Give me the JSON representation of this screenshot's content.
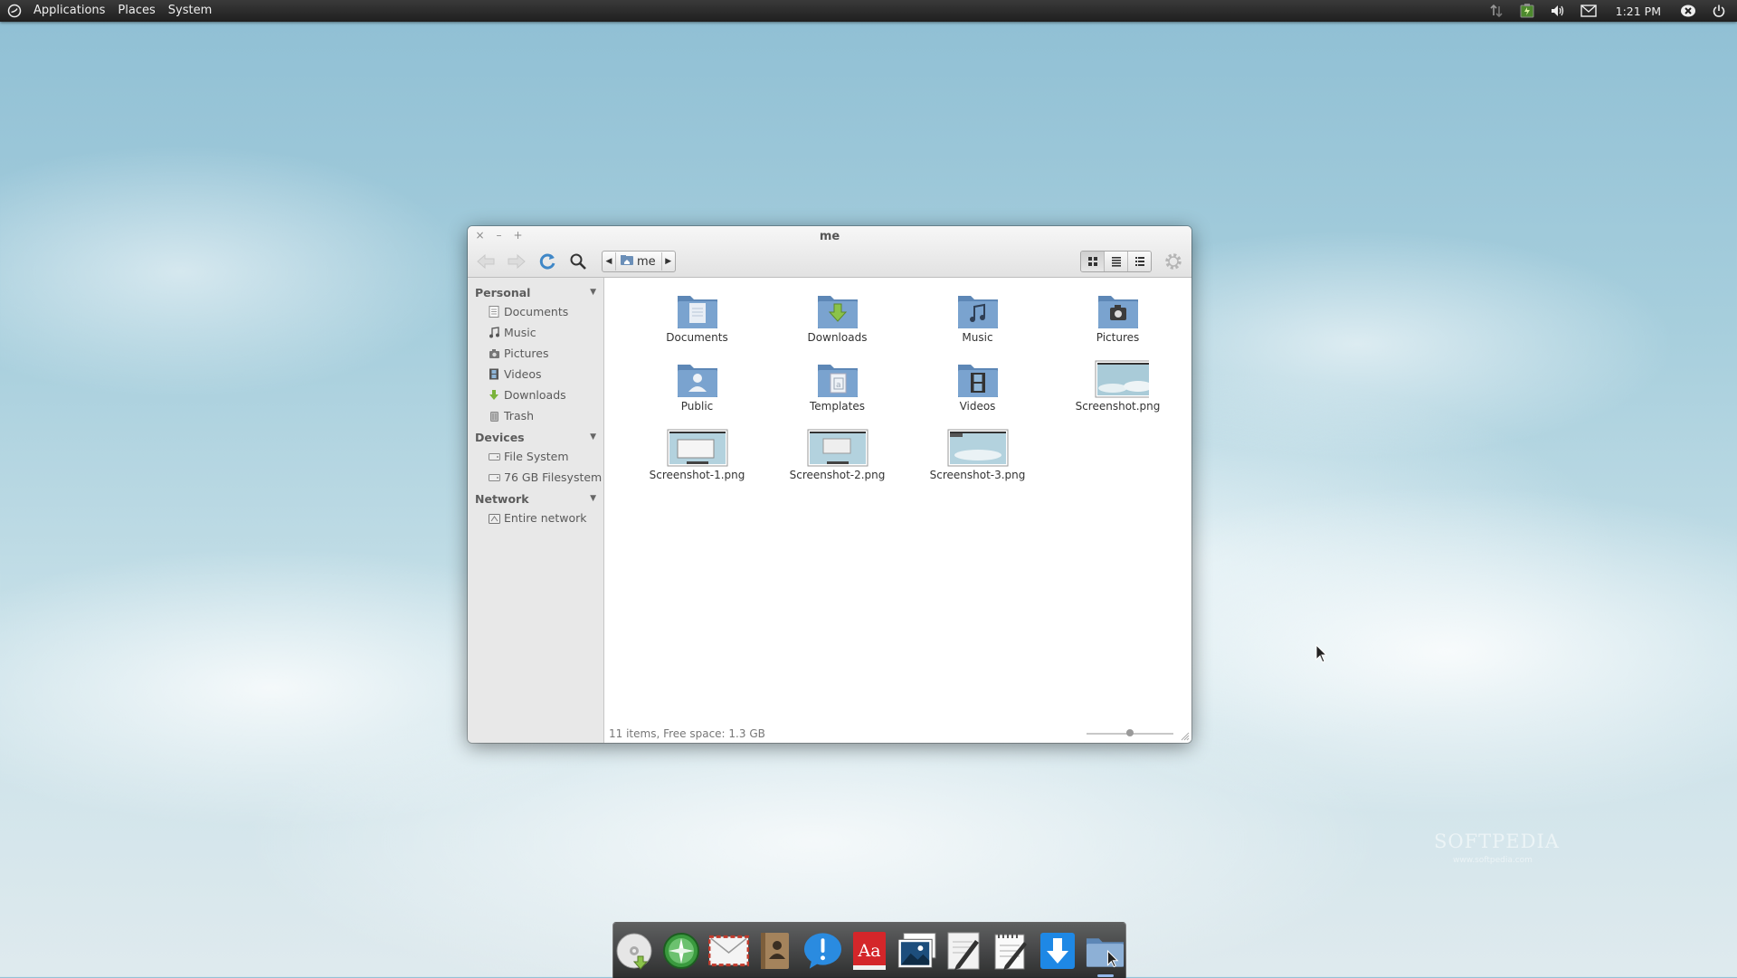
{
  "panel": {
    "menus": [
      "Applications",
      "Places",
      "System"
    ],
    "clock": "1:21 PM",
    "tray_icons": [
      "network-icon",
      "battery-icon",
      "volume-icon",
      "mail-icon",
      "user-status-icon",
      "power-icon"
    ]
  },
  "window": {
    "title": "me",
    "path": "me",
    "controls": [
      "×",
      "–",
      "+"
    ],
    "view_modes": [
      "icon-view",
      "list-view",
      "compact-view"
    ],
    "active_view": "icon-view"
  },
  "sidebar": {
    "sections": [
      {
        "title": "Personal",
        "items": [
          {
            "label": "Documents",
            "icon": "documents-icon"
          },
          {
            "label": "Music",
            "icon": "music-icon"
          },
          {
            "label": "Pictures",
            "icon": "pictures-icon"
          },
          {
            "label": "Videos",
            "icon": "videos-icon"
          },
          {
            "label": "Downloads",
            "icon": "downloads-icon"
          },
          {
            "label": "Trash",
            "icon": "trash-icon"
          }
        ]
      },
      {
        "title": "Devices",
        "items": [
          {
            "label": "File System",
            "icon": "filesystem-icon"
          },
          {
            "label": "76 GB Filesystem",
            "icon": "drive-icon"
          }
        ]
      },
      {
        "title": "Network",
        "items": [
          {
            "label": "Entire network",
            "icon": "network-icon"
          }
        ]
      }
    ]
  },
  "files": [
    {
      "label": "Documents",
      "kind": "folder",
      "emblem": "document"
    },
    {
      "label": "Downloads",
      "kind": "folder",
      "emblem": "download"
    },
    {
      "label": "Music",
      "kind": "folder",
      "emblem": "music"
    },
    {
      "label": "Pictures",
      "kind": "folder",
      "emblem": "camera"
    },
    {
      "label": "Public",
      "kind": "folder",
      "emblem": "person"
    },
    {
      "label": "Templates",
      "kind": "folder",
      "emblem": "template"
    },
    {
      "label": "Videos",
      "kind": "folder",
      "emblem": "film"
    },
    {
      "label": "Screenshot.png",
      "kind": "image"
    },
    {
      "label": "Screenshot-1.png",
      "kind": "image"
    },
    {
      "label": "Screenshot-2.png",
      "kind": "image"
    },
    {
      "label": "Screenshot-3.png",
      "kind": "image"
    }
  ],
  "status": {
    "text": "11 items, Free space: 1.3 GB",
    "zoom_level": 0.5
  },
  "dock": {
    "items": [
      {
        "name": "disc-utility-icon",
        "running": false
      },
      {
        "name": "browser-compass-icon",
        "running": false
      },
      {
        "name": "mail-icon",
        "running": false
      },
      {
        "name": "contacts-icon",
        "running": false
      },
      {
        "name": "chat-icon",
        "running": false
      },
      {
        "name": "dictionary-icon",
        "running": false
      },
      {
        "name": "photos-icon",
        "running": false
      },
      {
        "name": "text-editor-icon",
        "running": false
      },
      {
        "name": "notes-icon",
        "running": false
      },
      {
        "name": "downloader-icon",
        "running": false
      },
      {
        "name": "file-manager-icon",
        "running": true
      }
    ],
    "dictionary_glyph": "Aa"
  },
  "watermark": {
    "text": "SOFTPEDIA",
    "sub": "www.softpedia.com"
  }
}
